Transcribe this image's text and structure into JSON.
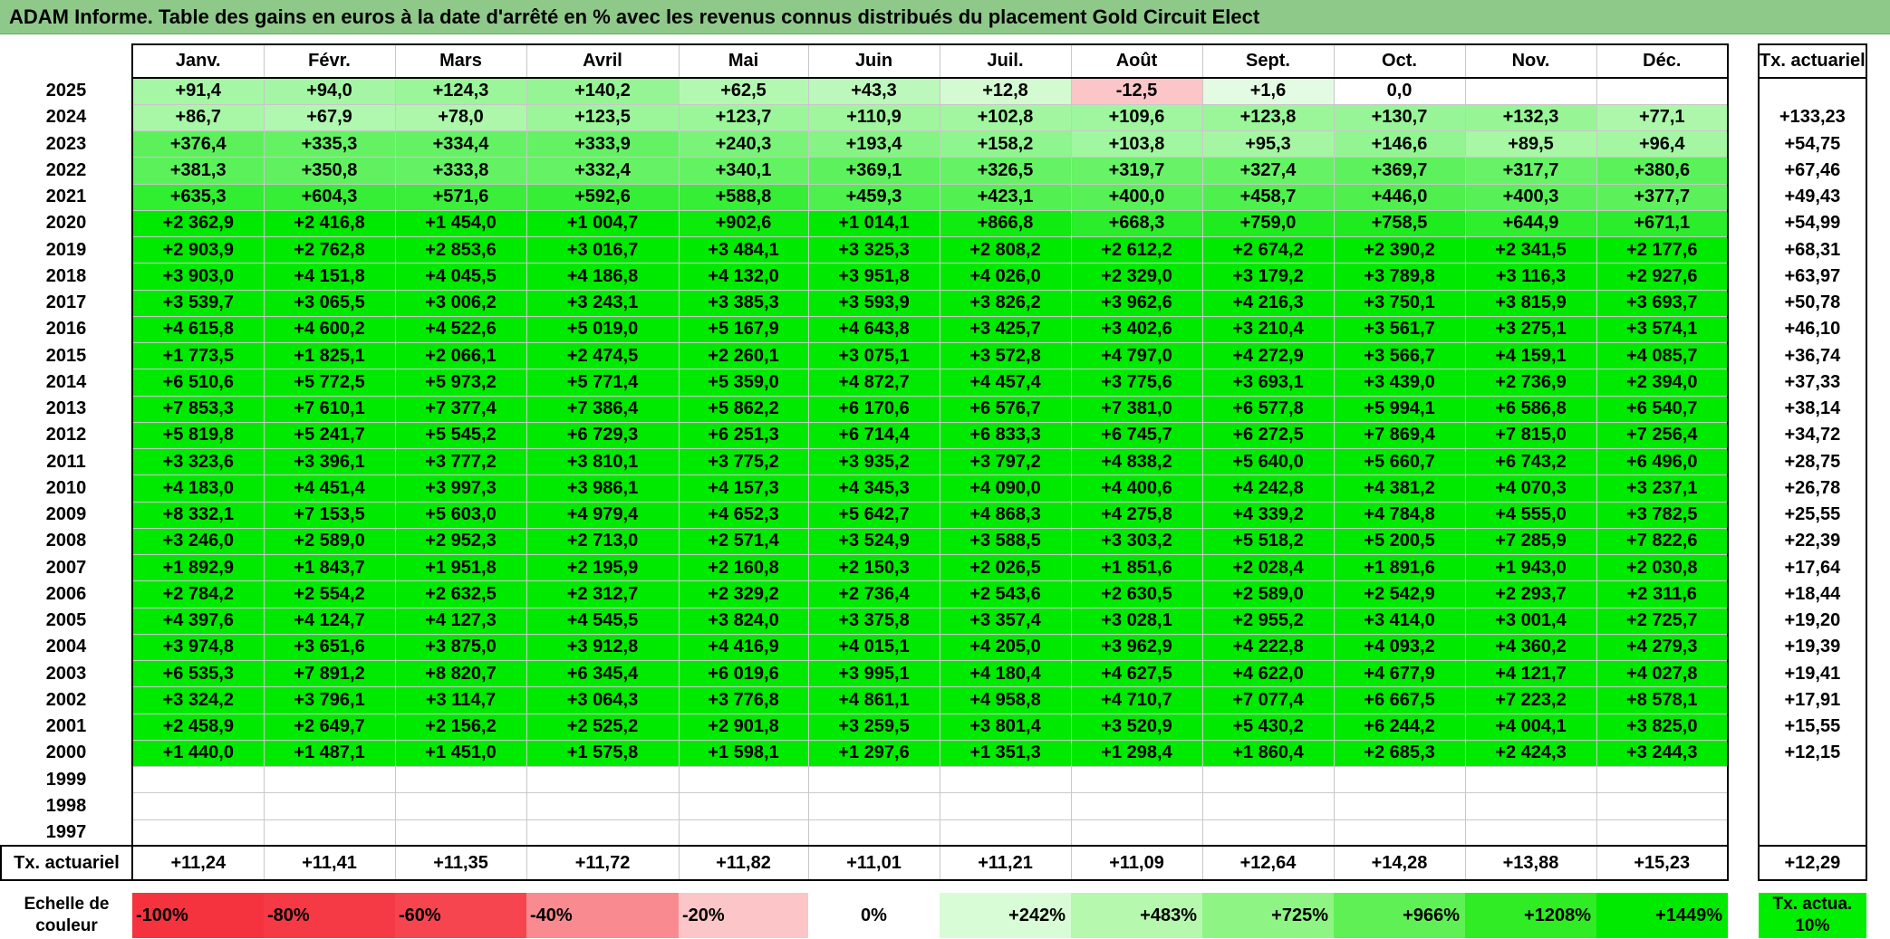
{
  "title": "ADAM Informe. Table des gains en euros à la date d'arrêté en % avec les revenus connus distribués du placement Gold Circuit Elect",
  "headers": {
    "months": [
      "Janv.",
      "Févr.",
      "Mars",
      "Avril",
      "Mai",
      "Juin",
      "Juil.",
      "Août",
      "Sept.",
      "Oct.",
      "Nov.",
      "Déc."
    ],
    "rate": "Tx. actuariel"
  },
  "rows": [
    {
      "year": "2025",
      "values": [
        "+91,4",
        "+94,0",
        "+124,3",
        "+140,2",
        "+62,5",
        "+43,3",
        "+12,8",
        "-12,5",
        "+1,6",
        "0,0",
        "",
        ""
      ],
      "rate": ""
    },
    {
      "year": "2024",
      "values": [
        "+86,7",
        "+67,9",
        "+78,0",
        "+123,5",
        "+123,7",
        "+110,9",
        "+102,8",
        "+109,6",
        "+123,8",
        "+130,7",
        "+132,3",
        "+77,1"
      ],
      "rate": "+133,23"
    },
    {
      "year": "2023",
      "values": [
        "+376,4",
        "+335,3",
        "+334,4",
        "+333,9",
        "+240,3",
        "+193,4",
        "+158,2",
        "+103,8",
        "+95,3",
        "+146,6",
        "+89,5",
        "+96,4"
      ],
      "rate": "+54,75"
    },
    {
      "year": "2022",
      "values": [
        "+381,3",
        "+350,8",
        "+333,8",
        "+332,4",
        "+340,1",
        "+369,1",
        "+326,5",
        "+319,7",
        "+327,4",
        "+369,7",
        "+317,7",
        "+380,6"
      ],
      "rate": "+67,46"
    },
    {
      "year": "2021",
      "values": [
        "+635,3",
        "+604,3",
        "+571,6",
        "+592,6",
        "+588,8",
        "+459,3",
        "+423,1",
        "+400,0",
        "+458,7",
        "+446,0",
        "+400,3",
        "+377,7"
      ],
      "rate": "+49,43"
    },
    {
      "year": "2020",
      "values": [
        "+2 362,9",
        "+2 416,8",
        "+1 454,0",
        "+1 004,7",
        "+902,6",
        "+1 014,1",
        "+866,8",
        "+668,3",
        "+759,0",
        "+758,5",
        "+644,9",
        "+671,1"
      ],
      "rate": "+54,99"
    },
    {
      "year": "2019",
      "values": [
        "+2 903,9",
        "+2 762,8",
        "+2 853,6",
        "+3 016,7",
        "+3 484,1",
        "+3 325,3",
        "+2 808,2",
        "+2 612,2",
        "+2 674,2",
        "+2 390,2",
        "+2 341,5",
        "+2 177,6"
      ],
      "rate": "+68,31"
    },
    {
      "year": "2018",
      "values": [
        "+3 903,0",
        "+4 151,8",
        "+4 045,5",
        "+4 186,8",
        "+4 132,0",
        "+3 951,8",
        "+4 026,0",
        "+2 329,0",
        "+3 179,2",
        "+3 789,8",
        "+3 116,3",
        "+2 927,6"
      ],
      "rate": "+63,97"
    },
    {
      "year": "2017",
      "values": [
        "+3 539,7",
        "+3 065,5",
        "+3 006,2",
        "+3 243,1",
        "+3 385,3",
        "+3 593,9",
        "+3 826,2",
        "+3 962,6",
        "+4 216,3",
        "+3 750,1",
        "+3 815,9",
        "+3 693,7"
      ],
      "rate": "+50,78"
    },
    {
      "year": "2016",
      "values": [
        "+4 615,8",
        "+4 600,2",
        "+4 522,6",
        "+5 019,0",
        "+5 167,9",
        "+4 643,8",
        "+3 425,7",
        "+3 402,6",
        "+3 210,4",
        "+3 561,7",
        "+3 275,1",
        "+3 574,1"
      ],
      "rate": "+46,10"
    },
    {
      "year": "2015",
      "values": [
        "+1 773,5",
        "+1 825,1",
        "+2 066,1",
        "+2 474,5",
        "+2 260,1",
        "+3 075,1",
        "+3 572,8",
        "+4 797,0",
        "+4 272,9",
        "+3 566,7",
        "+4 159,1",
        "+4 085,7"
      ],
      "rate": "+36,74"
    },
    {
      "year": "2014",
      "values": [
        "+6 510,6",
        "+5 772,5",
        "+5 973,2",
        "+5 771,4",
        "+5 359,0",
        "+4 872,7",
        "+4 457,4",
        "+3 775,6",
        "+3 693,1",
        "+3 439,0",
        "+2 736,9",
        "+2 394,0"
      ],
      "rate": "+37,33"
    },
    {
      "year": "2013",
      "values": [
        "+7 853,3",
        "+7 610,1",
        "+7 377,4",
        "+7 386,4",
        "+5 862,2",
        "+6 170,6",
        "+6 576,7",
        "+7 381,0",
        "+6 577,8",
        "+5 994,1",
        "+6 586,8",
        "+6 540,7"
      ],
      "rate": "+38,14"
    },
    {
      "year": "2012",
      "values": [
        "+5 819,8",
        "+5 241,7",
        "+5 545,2",
        "+6 729,3",
        "+6 251,3",
        "+6 714,4",
        "+6 833,3",
        "+6 745,7",
        "+6 272,5",
        "+7 869,4",
        "+7 815,0",
        "+7 256,4"
      ],
      "rate": "+34,72"
    },
    {
      "year": "2011",
      "values": [
        "+3 323,6",
        "+3 396,1",
        "+3 777,2",
        "+3 810,1",
        "+3 775,2",
        "+3 935,2",
        "+3 797,2",
        "+4 838,2",
        "+5 640,0",
        "+5 660,7",
        "+6 743,2",
        "+6 496,0"
      ],
      "rate": "+28,75"
    },
    {
      "year": "2010",
      "values": [
        "+4 183,0",
        "+4 451,4",
        "+3 997,3",
        "+3 986,1",
        "+4 157,3",
        "+4 345,3",
        "+4 090,0",
        "+4 400,6",
        "+4 242,8",
        "+4 381,2",
        "+4 070,3",
        "+3 237,1"
      ],
      "rate": "+26,78"
    },
    {
      "year": "2009",
      "values": [
        "+8 332,1",
        "+7 153,5",
        "+5 603,0",
        "+4 979,4",
        "+4 652,3",
        "+5 642,7",
        "+4 868,3",
        "+4 275,8",
        "+4 339,2",
        "+4 784,8",
        "+4 555,0",
        "+3 782,5"
      ],
      "rate": "+25,55"
    },
    {
      "year": "2008",
      "values": [
        "+3 246,0",
        "+2 589,0",
        "+2 952,3",
        "+2 713,0",
        "+2 571,4",
        "+3 524,9",
        "+3 588,5",
        "+3 303,2",
        "+5 518,2",
        "+5 200,5",
        "+7 285,9",
        "+7 822,6"
      ],
      "rate": "+22,39"
    },
    {
      "year": "2007",
      "values": [
        "+1 892,9",
        "+1 843,7",
        "+1 951,8",
        "+2 195,9",
        "+2 160,8",
        "+2 150,3",
        "+2 026,5",
        "+1 851,6",
        "+2 028,4",
        "+1 891,6",
        "+1 943,0",
        "+2 030,8"
      ],
      "rate": "+17,64"
    },
    {
      "year": "2006",
      "values": [
        "+2 784,2",
        "+2 554,2",
        "+2 632,5",
        "+2 312,7",
        "+2 329,2",
        "+2 736,4",
        "+2 543,6",
        "+2 630,5",
        "+2 589,0",
        "+2 542,9",
        "+2 293,7",
        "+2 311,6"
      ],
      "rate": "+18,44"
    },
    {
      "year": "2005",
      "values": [
        "+4 397,6",
        "+4 124,7",
        "+4 127,3",
        "+4 545,5",
        "+3 824,0",
        "+3 375,8",
        "+3 357,4",
        "+3 028,1",
        "+2 955,2",
        "+3 414,0",
        "+3 001,4",
        "+2 725,7"
      ],
      "rate": "+19,20"
    },
    {
      "year": "2004",
      "values": [
        "+3 974,8",
        "+3 651,6",
        "+3 875,0",
        "+3 912,8",
        "+4 416,9",
        "+4 015,1",
        "+4 205,0",
        "+3 962,9",
        "+4 222,8",
        "+4 093,2",
        "+4 360,2",
        "+4 279,3"
      ],
      "rate": "+19,39"
    },
    {
      "year": "2003",
      "values": [
        "+6 535,3",
        "+7 891,2",
        "+8 820,7",
        "+6 345,4",
        "+6 019,6",
        "+3 995,1",
        "+4 180,4",
        "+4 627,5",
        "+4 622,0",
        "+4 677,9",
        "+4 121,7",
        "+4 027,8"
      ],
      "rate": "+19,41"
    },
    {
      "year": "2002",
      "values": [
        "+3 324,2",
        "+3 796,1",
        "+3 114,7",
        "+3 064,3",
        "+3 776,8",
        "+4 861,1",
        "+4 958,8",
        "+4 710,7",
        "+7 077,4",
        "+6 667,5",
        "+7 223,2",
        "+8 578,1"
      ],
      "rate": "+17,91"
    },
    {
      "year": "2001",
      "values": [
        "+2 458,9",
        "+2 649,7",
        "+2 156,2",
        "+2 525,2",
        "+2 901,8",
        "+3 259,5",
        "+3 801,4",
        "+3 520,9",
        "+5 430,2",
        "+6 244,2",
        "+4 004,1",
        "+3 825,0"
      ],
      "rate": "+15,55"
    },
    {
      "year": "2000",
      "values": [
        "+1 440,0",
        "+1 487,1",
        "+1 451,0",
        "+1 575,8",
        "+1 598,1",
        "+1 297,6",
        "+1 351,3",
        "+1 298,4",
        "+1 860,4",
        "+2 685,3",
        "+2 424,3",
        "+3 244,3"
      ],
      "rate": "+12,15"
    },
    {
      "year": "1999",
      "values": [
        "",
        "",
        "",
        "",
        "",
        "",
        "",
        "",
        "",
        "",
        "",
        ""
      ],
      "rate": ""
    },
    {
      "year": "1998",
      "values": [
        "",
        "",
        "",
        "",
        "",
        "",
        "",
        "",
        "",
        "",
        "",
        ""
      ],
      "rate": ""
    },
    {
      "year": "1997",
      "values": [
        "",
        "",
        "",
        "",
        "",
        "",
        "",
        "",
        "",
        "",
        "",
        ""
      ],
      "rate": ""
    }
  ],
  "totals": {
    "label": "Tx. actuariel",
    "values": [
      "+11,24",
      "+11,41",
      "+11,35",
      "+11,72",
      "+11,82",
      "+11,01",
      "+11,21",
      "+11,09",
      "+12,64",
      "+14,28",
      "+13,88",
      "+15,23"
    ],
    "rate": "+12,29"
  },
  "scale": {
    "label": "Echelle de couleur",
    "steps": [
      {
        "text": "-100%",
        "color": "#f5333f",
        "kind": "neg"
      },
      {
        "text": "-80%",
        "color": "#f53a45",
        "kind": "neg"
      },
      {
        "text": "-60%",
        "color": "#f6454f",
        "kind": "neg"
      },
      {
        "text": "-40%",
        "color": "#f98a90",
        "kind": "neg"
      },
      {
        "text": "-20%",
        "color": "#fcc5c8",
        "kind": "neg"
      },
      {
        "text": "0%",
        "color": "#ffffff",
        "kind": "zero"
      },
      {
        "text": "+242%",
        "color": "#d8fcd5",
        "kind": "pos"
      },
      {
        "text": "+483%",
        "color": "#b5f8ae",
        "kind": "pos"
      },
      {
        "text": "+725%",
        "color": "#8ef584",
        "kind": "pos"
      },
      {
        "text": "+966%",
        "color": "#5ff055",
        "kind": "pos"
      },
      {
        "text": "+1208%",
        "color": "#2fec24",
        "kind": "pos"
      },
      {
        "text": "+1449%",
        "color": "#00ea00",
        "kind": "pos"
      }
    ],
    "legend": "Tx. actua. 10%"
  },
  "colors": {
    "title_bg": "#8fc98a",
    "green_full": "#00ea00",
    "negative": "#fcc5c8"
  }
}
